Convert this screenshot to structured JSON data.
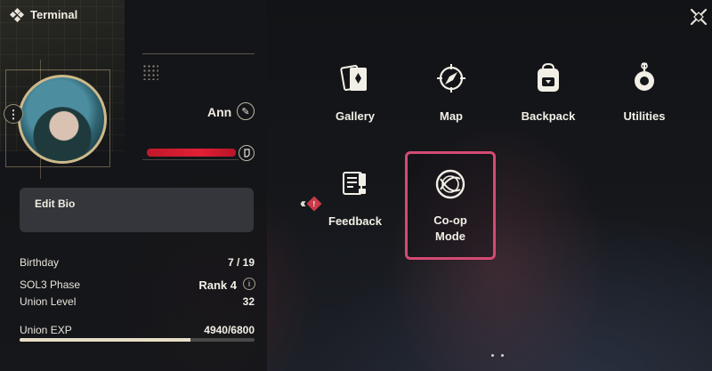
{
  "window": {
    "title": "Terminal",
    "title_icon": "diamond-cluster-icon",
    "close_icon": "close-icon"
  },
  "profile": {
    "name": "Ann",
    "edit_name_icon": "pencil-icon",
    "uid_redacted": true,
    "copy_uid_icon": "copy-icon",
    "avatar_menu_label": "⋮",
    "bio_label": "Edit Bio"
  },
  "stats": {
    "birthday_label": "Birthday",
    "birthday_value": "7 / 19",
    "phase_label": "SOL3 Phase",
    "phase_value": "Rank 4",
    "phase_info_icon": "i",
    "union_level_label": "Union Level",
    "union_level_value": "32",
    "union_exp_label": "Union EXP",
    "union_exp_value": "4940/6800",
    "union_exp_progress": 0.7265
  },
  "collapse": {
    "arrows": "«",
    "badge": "!"
  },
  "menu": {
    "gallery": {
      "label": "Gallery",
      "icon": "cards-icon"
    },
    "map": {
      "label": "Map",
      "icon": "compass-icon"
    },
    "backpack": {
      "label": "Backpack",
      "icon": "backpack-icon"
    },
    "utilities": {
      "label": "Utilities",
      "icon": "gear-bomb-icon"
    },
    "feedback": {
      "label": "Feedback",
      "icon": "feedback-icon"
    },
    "coop": {
      "label_line1": "Co-op",
      "label_line2": "Mode",
      "icon": "coop-sphere-icon",
      "highlight_color": "#d44a73"
    }
  },
  "colors": {
    "accent_gold": "#cdb98a",
    "redaction": "#e02035",
    "badge": "#c83a4a"
  }
}
